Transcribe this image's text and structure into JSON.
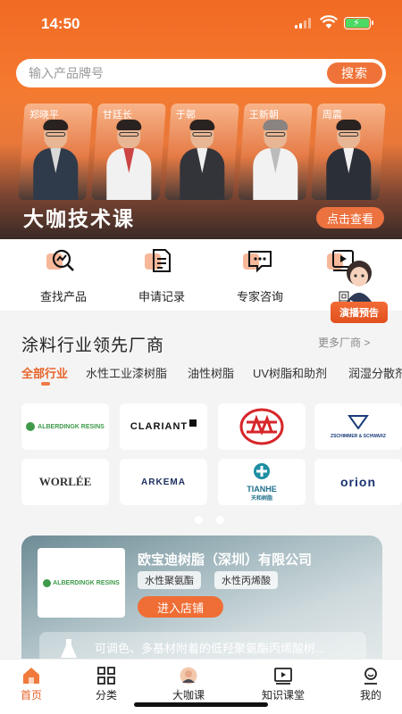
{
  "status": {
    "time": "14:50"
  },
  "search": {
    "placeholder": "输入产品牌号",
    "button_label": "搜索"
  },
  "hero": {
    "experts": [
      "郑晓平",
      "甘廷长",
      "于鄣",
      "王新朝",
      "周震"
    ],
    "title": "大咖技术课",
    "cta_label": "点击查看"
  },
  "quick_entries": [
    {
      "label": "查找产品",
      "icon": "product-search-icon"
    },
    {
      "label": "申请记录",
      "icon": "document-icon"
    },
    {
      "label": "专家咨询",
      "icon": "chat-icon"
    },
    {
      "label": "回",
      "icon": "video-icon"
    }
  ],
  "promo": {
    "label": "演播预告"
  },
  "manufacturers": {
    "title": "涂料行业领先厂商",
    "more_label": "更多厂商 >",
    "tabs": [
      "全部行业",
      "水性工业漆树脂",
      "油性树脂",
      "UV树脂和助剂",
      "润湿分散剂"
    ],
    "active_tab": 0,
    "logos": [
      "ALBERDINGK RESINS",
      "CLARIANT",
      "",
      "ZSCHIMMER & SCHWARZ",
      "WORLÉE",
      "ARKEMA",
      "TIANHE",
      "orion"
    ],
    "logo_subtexts": {
      "tianhe": "天和树脂"
    }
  },
  "company": {
    "logo_text": "ALBERDINGK RESINS",
    "name": "欧宝迪树脂（深圳）有限公司",
    "tags": [
      "水性聚氨酯",
      "水性丙烯酸"
    ],
    "cta_label": "进入店铺",
    "description": "可调色、多基材附着的低羟聚氨酯丙烯酸树..."
  },
  "bottom_nav": [
    {
      "label": "首页",
      "icon": "home-icon",
      "active": true
    },
    {
      "label": "分类",
      "icon": "grid-icon",
      "active": false
    },
    {
      "label": "大咖课",
      "icon": "expert-avatar-icon",
      "active": false
    },
    {
      "label": "知识课堂",
      "icon": "play-icon",
      "active": false
    },
    {
      "label": "我的",
      "icon": "user-icon",
      "active": false
    }
  ],
  "colors": {
    "brand": "#ef7338",
    "active": "#e8642a"
  }
}
